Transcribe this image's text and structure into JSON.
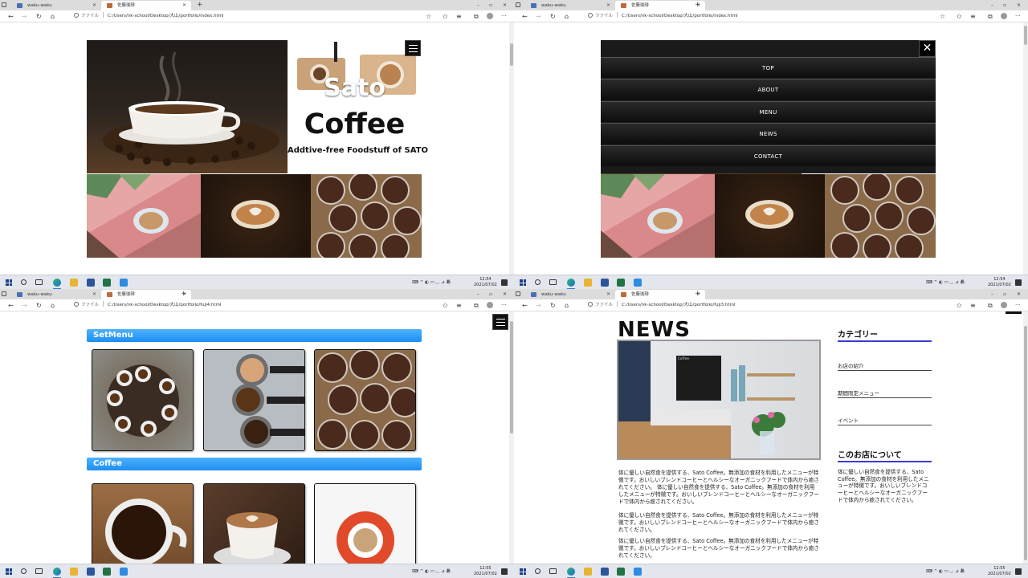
{
  "windows": [
    {
      "tabs": [
        {
          "label": "waku-waku"
        },
        {
          "label": "佐藤珈琲"
        }
      ],
      "url": "C:/Users/nk-school/Desktop/大山/portfolio/index.html",
      "addr_label": "ファイル",
      "clock_time": "12:54",
      "clock_date": "2021/07/02"
    },
    {
      "tabs": [
        {
          "label": "waku-waku"
        },
        {
          "label": "佐藤珈琲"
        }
      ],
      "url": "C:/Users/nk-school/Desktop/大山/portfolio/index.html",
      "addr_label": "ファイル",
      "clock_time": "12:54",
      "clock_date": "2021/07/02"
    },
    {
      "tabs": [
        {
          "label": "waku-waku"
        },
        {
          "label": "佐藤珈琲"
        }
      ],
      "url": "C:/Users/nk-school/Desktop/大山/portfolio/fuji4.html",
      "addr_label": "ファイル",
      "clock_time": "12:55",
      "clock_date": "2021/07/02"
    },
    {
      "tabs": [
        {
          "label": "waku-waku"
        },
        {
          "label": "佐藤珈琲"
        }
      ],
      "url": "C:/Users/nk-school/Desktop/大山/portfolio/fuji3.html",
      "addr_label": "ファイル",
      "clock_time": "12:55",
      "clock_date": "2021/07/02"
    }
  ],
  "home": {
    "title_line1": "Sato",
    "title_line2": "Coffee",
    "tagline": "Addtive-free Foodstuff of SATO"
  },
  "menu": {
    "items": [
      "TOP",
      "ABOUT",
      "MENU",
      "NEWS",
      "CONTACT"
    ],
    "close_icon": "close-icon"
  },
  "products": {
    "sections": [
      {
        "title": "SetMenu"
      },
      {
        "title": "Coffee"
      }
    ]
  },
  "news": {
    "heading": "NEWS",
    "sidebar_title": "カテゴリー",
    "categories": [
      "お店の紹介",
      "期間限定メニュー",
      "イベント"
    ],
    "about_title": "このお店について",
    "about_text": "体に優しい自然食を提供する、Sato Coffee。無添加の食材を利用したメニューが特徴です。おいしいブレンドコーヒーとヘルシーなオーガニックフードで体内から癒されてください。",
    "para1": "体に優しい自然食を提供する、Sato Coffee。無添加の食材を利用したメニューが特徴です。おいしいブレンドコーヒーとヘルシーなオーガニックフードで体内から癒されてください。 体に優しい自然食を提供する、Sato Coffee。無添加の食材を利用したメニューが特徴です。おいしいブレンドコーヒーとヘルシーなオーガニックフードで体内から癒されてください。",
    "para2": "体に優しい自然食を提供する、Sato Coffee。無添加の食材を利用したメニューが特徴です。おいしいブレンドコーヒーとヘルシーなオーガニックフードで体内から癒されてください。",
    "para3": "体に優しい自然食を提供する、Sato Coffee。無添加の食材を利用したメニューが特徴です。おいしいブレンドコーヒーとヘルシーなオーガニックフードで体内から癒されてください。",
    "board_text": "Coffee"
  },
  "tray": {
    "ime": "あ"
  },
  "icons": {
    "refresh": "refresh-icon",
    "home": "home-icon",
    "back": "back-arrow-icon",
    "forward": "forward-arrow-icon"
  }
}
